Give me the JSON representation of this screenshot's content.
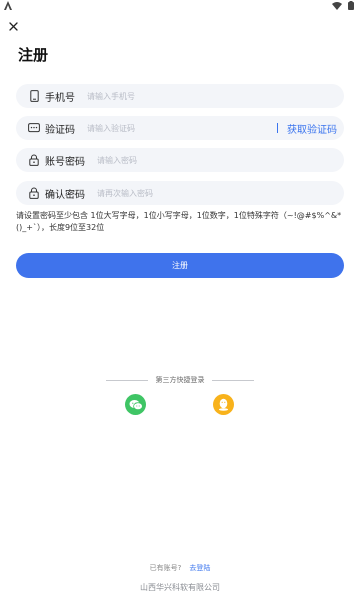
{
  "header": {
    "title": "注册"
  },
  "form": {
    "phone": {
      "label": "手机号",
      "placeholder": "请输入手机号",
      "value": ""
    },
    "code": {
      "label": "验证码",
      "placeholder": "请输入验证码",
      "value": "",
      "get_code_label": "获取验证码"
    },
    "password": {
      "label": "账号密码",
      "placeholder": "请输入密码",
      "value": ""
    },
    "confirm": {
      "label": "确认密码",
      "placeholder": "请再次输入密码",
      "value": ""
    },
    "hint": "请设置密码至少包含 1位大写字母，1位小写字母，1位数字，1位特殊字符（~!@#$%^&*()_+`），长度9位至32位",
    "submit_label": "注册"
  },
  "third_party": {
    "label": "第三方快捷登录",
    "providers": [
      "wechat-icon",
      "qq-icon"
    ]
  },
  "footer": {
    "has_account": "已有账号?",
    "login_label": "去登陆",
    "company": "山西华兴科软有限公司"
  },
  "colors": {
    "accent": "#3f73ec",
    "field_bg": "#f3f5f9",
    "wechat": "#3fc565",
    "qq": "#f8b21b"
  }
}
